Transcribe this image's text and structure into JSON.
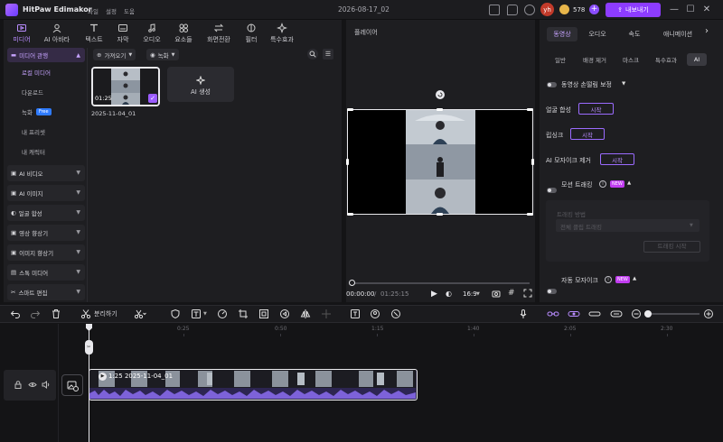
{
  "app": {
    "name": "HitPaw Edimakor",
    "menu": [
      "파일",
      "설정",
      "도움"
    ],
    "project_title": "2026-08-17_02",
    "user_initials": "yh",
    "credits": "578",
    "export_label": "내보내기"
  },
  "media_tabs": [
    {
      "label": "미디어",
      "icon": "media-icon",
      "active": true
    },
    {
      "label": "AI 아바타",
      "icon": "ai-avatar-icon"
    },
    {
      "label": "텍스트",
      "icon": "text-icon"
    },
    {
      "label": "자막",
      "icon": "subtitle-icon"
    },
    {
      "label": "오디오",
      "icon": "audio-icon"
    },
    {
      "label": "요소들",
      "icon": "elements-icon"
    },
    {
      "label": "화면전환",
      "icon": "transition-icon"
    },
    {
      "label": "필터",
      "icon": "filter-icon"
    },
    {
      "label": "특수효과",
      "icon": "effects-icon"
    }
  ],
  "side_nav": {
    "parent_label": "미디어 관행",
    "sub_items": [
      "로컬 미디어",
      "다운로드",
      "녹화",
      "내 프리셋",
      "내 캐릭터"
    ],
    "free_badge": "Free",
    "categories": [
      "AI 비디오",
      "AI 이미지",
      "얼굴 합성",
      "영상 향상기",
      "이미지 향상기",
      "스톡 미디어",
      "스마트 편집"
    ]
  },
  "media_toolbar": {
    "import_label": "가져오기",
    "record_label": "녹화"
  },
  "media_items": [
    {
      "duration": "01:25",
      "name": "2025-11-04_01"
    }
  ],
  "ai_generate_label": "AI 생성",
  "player": {
    "title": "플레이어",
    "current_time": "00:00:00",
    "total_time": "01:25:15",
    "aspect": "16:9"
  },
  "props": {
    "tabs": [
      "동영상",
      "오디오",
      "속도",
      "애니메이션"
    ],
    "subtabs": [
      "일반",
      "배경 제거",
      "마스크",
      "특수효과",
      "AI"
    ],
    "stabilize_label": "동영상 손떨림 보정",
    "face_swap_label": "얼굴 합성",
    "lip_sync_label": "립싱크",
    "ai_mosaic_remove_label": "AI 모자이크 제거",
    "start_label": "시작",
    "motion_tracking_label": "모션 트래킹",
    "tracking_method_label": "트래킹 방법",
    "tracking_select": "전체 클립 트래킹",
    "tracking_start_label": "트래킹 시작",
    "auto_mosaic_label": "자동 모자이크",
    "new_badge": "NEW"
  },
  "timeline": {
    "split_label": "분리하기",
    "ruler": [
      "0:25",
      "0:50",
      "1:15",
      "1:40",
      "2:05",
      "2:30"
    ],
    "clip_label": "1:25  2025-11-04_01"
  },
  "colors": {
    "accent": "#8d3cff",
    "accent_text": "#b98cff",
    "panel": "#1e1e21",
    "background": "#141416",
    "new_badge": "#c13cf0",
    "free_badge": "#2f7bff"
  }
}
